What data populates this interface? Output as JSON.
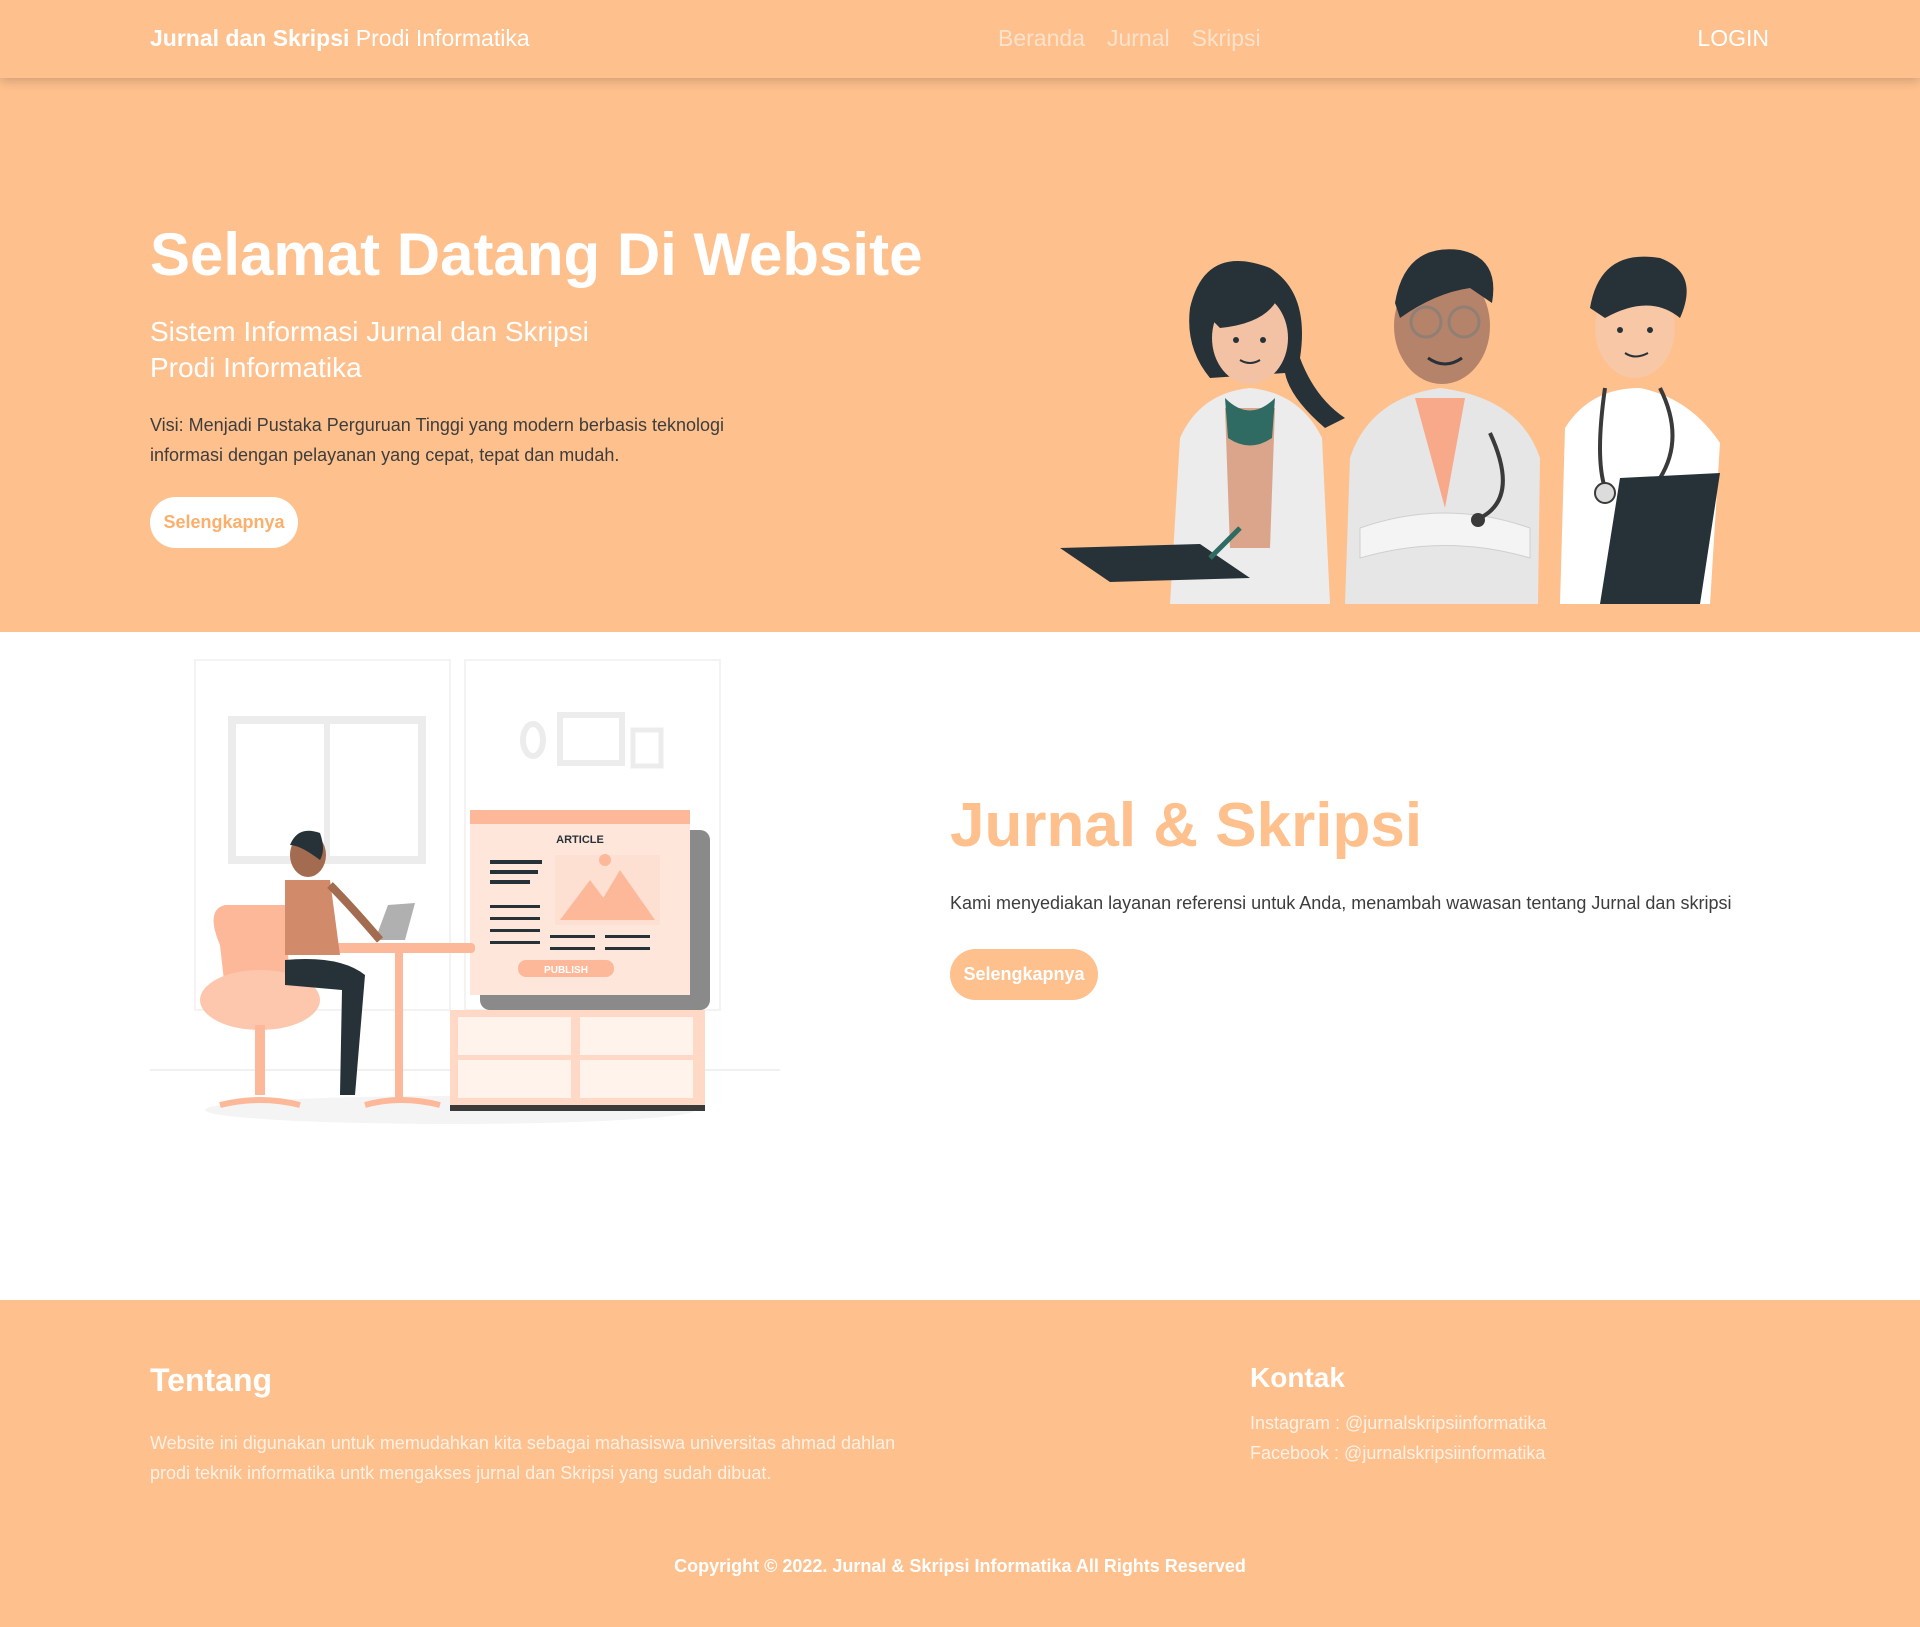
{
  "navbar": {
    "brand_bold": "Jurnal dan Skripsi",
    "brand_light": "Prodi Informatika",
    "links": [
      "Beranda",
      "Jurnal",
      "Skripsi"
    ],
    "login_label": "LOGIN"
  },
  "hero": {
    "title": "Selamat Datang Di Website",
    "subtitle_line1": "Sistem Informasi Jurnal dan Skripsi",
    "subtitle_line2": "Prodi Informatika",
    "visi_line1": "Visi: Menjadi Pustaka Perguruan Tinggi yang modern berbasis teknologi",
    "visi_line2": "informasi dengan pelayanan yang cepat, tepat dan mudah.",
    "button_label": "Selengkapnya"
  },
  "about": {
    "illustration": {
      "article_label": "ARTICLE",
      "publish_label": "PUBLISH"
    },
    "title": "Jurnal & Skripsi",
    "text": "Kami menyediakan layanan referensi untuk Anda, menambah wawasan tentang Jurnal dan skripsi",
    "button_label": "Selengkapnya"
  },
  "footer": {
    "tentang_heading": "Tentang",
    "tentang_line1": "Website ini digunakan untuk memudahkan kita sebagai mahasiswa universitas ahmad dahlan",
    "tentang_line2": "prodi teknik informatika untk mengakses jurnal dan Skripsi yang sudah dibuat.",
    "kontak_heading": "Kontak",
    "instagram": "Instagram : @jurnalskripsiinformatika",
    "facebook": "Facebook : @jurnalskripsiinformatika",
    "copyright": "Copyright © 2022. Jurnal & Skripsi Informatika All Rights Reserved"
  },
  "colors": {
    "accent": "#fec08d",
    "accent_dark": "#fdae6b",
    "white": "#ffffff",
    "text_dark": "#3d3d3d"
  }
}
